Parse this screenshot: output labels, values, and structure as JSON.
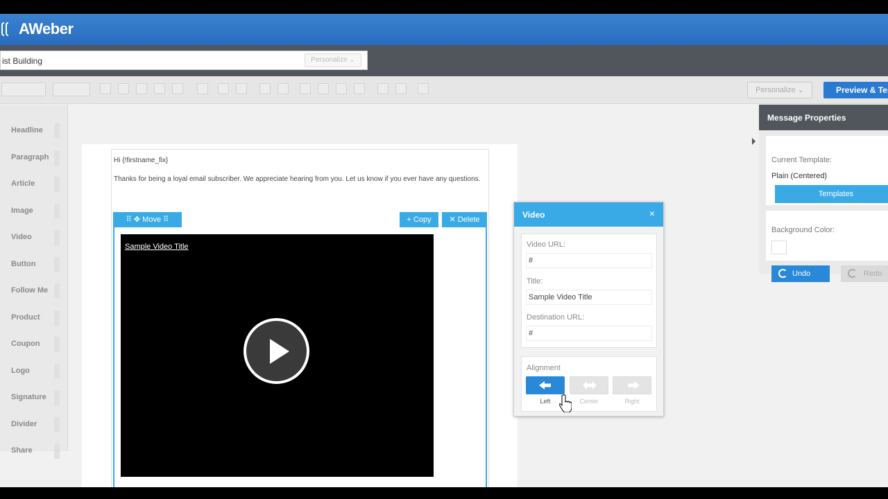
{
  "header": {
    "brand": "AWeber"
  },
  "subject_bar": {
    "subject_value": "ist Building",
    "personalize_label": "Personalize"
  },
  "toolbar": {
    "personalize_label": "Personalize",
    "preview_label": "Preview & Test"
  },
  "sidebar": {
    "items": [
      {
        "label": "Headline"
      },
      {
        "label": "Paragraph"
      },
      {
        "label": "Article"
      },
      {
        "label": "Image"
      },
      {
        "label": "Video"
      },
      {
        "label": "Button"
      },
      {
        "label": "Follow Me"
      },
      {
        "label": "Product"
      },
      {
        "label": "Coupon"
      },
      {
        "label": "Logo"
      },
      {
        "label": "Signature"
      },
      {
        "label": "Divider"
      },
      {
        "label": "Share"
      }
    ]
  },
  "email": {
    "greeting": "Hi {!firstname_fix}",
    "body": "Thanks for being a loyal email subscriber. We appreciate hearing from you. Let us know if you ever have any questions.",
    "move_label": "Move",
    "copy_label": "Copy",
    "delete_label": "Delete",
    "video_title": "Sample Video Title"
  },
  "video_dialog": {
    "title": "Video",
    "close": "×",
    "video_url_label": "Video URL:",
    "video_url_value": "#",
    "title_label": "Title:",
    "title_value": "Sample Video Title",
    "destination_label": "Destination URL:",
    "destination_value": "#",
    "alignment_label": "Alignment",
    "alignment_options": [
      {
        "label": "Left",
        "active": true,
        "icon": "arrow-left-icon"
      },
      {
        "label": "Center",
        "active": false,
        "icon": "arrows-center-icon"
      },
      {
        "label": "Right",
        "active": false,
        "icon": "arrow-right-icon"
      }
    ]
  },
  "properties": {
    "title": "Message Properties",
    "current_template_label": "Current Template:",
    "current_template_value": "Plain (Centered)",
    "templates_button": "Templates",
    "background_label": "Background Color:",
    "background_color": "#ffffff",
    "undo_label": "Undo",
    "redo_label": "Redo"
  },
  "colors": {
    "header_blue": "#2a6cc0",
    "accent_blue": "#3aaae6",
    "button_blue": "#2a88d8",
    "dark_bar": "#50565c"
  }
}
